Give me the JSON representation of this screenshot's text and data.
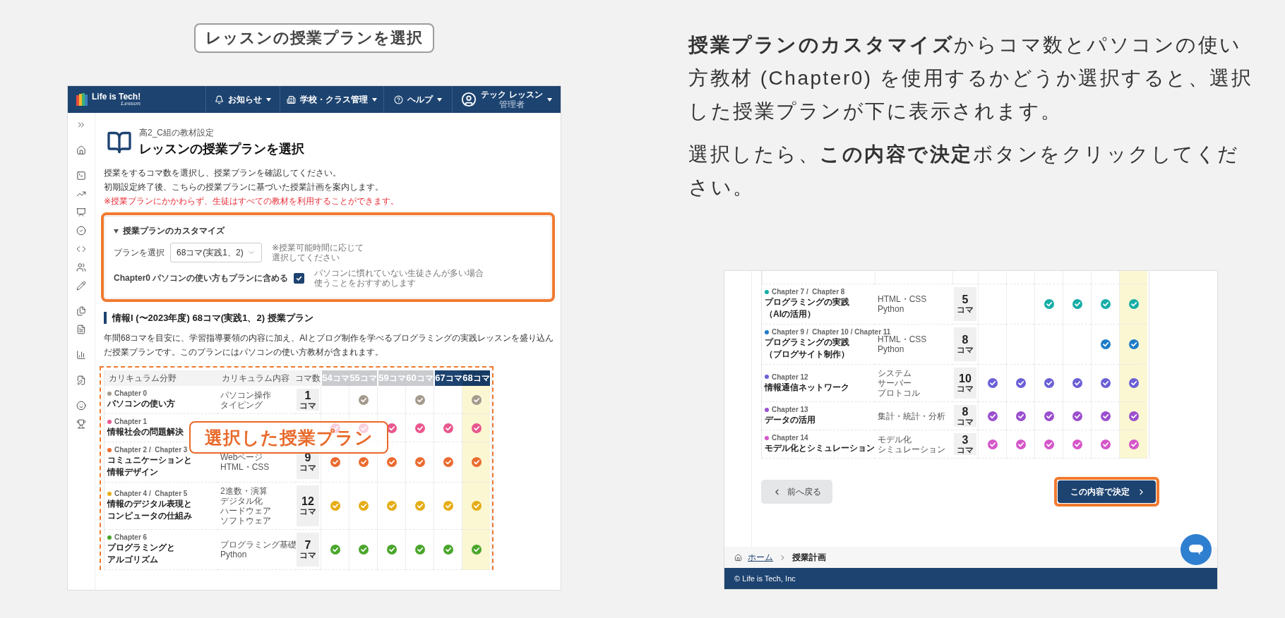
{
  "caption": "レッスンの授業プランを選択",
  "explanation": [
    "**授業プランのカスタマイズ**からコマ数とパソコンの使い方教材 (Chapter0) を使用するかどうか選択すると、選択した授業プランが下に表示されます。",
    "選択したら、**この内容で決定**ボタンをクリックしてください。"
  ],
  "screenshot_top": {
    "header": {
      "logo": "Life is Tech!",
      "logo_sub": "Lesson",
      "nav": [
        {
          "kind": "bell",
          "label": "お知らせ"
        },
        {
          "kind": "building",
          "label": "学校・クラス管理"
        },
        {
          "kind": "help",
          "label": "ヘルプ"
        }
      ],
      "user": {
        "name": "テック レッスン",
        "role": "管理者"
      }
    },
    "subtitle": "高2_C組の教材設定",
    "title": "レッスンの授業プランを選択",
    "intro": [
      "授業をするコマ数を選択し、授業プランを確認してください。",
      "初期設定終了後、こちらの授業プランに基づいた授業計画を案内します。"
    ],
    "notice": "※授業プランにかかわらず、生徒はすべての教材を利用することができます。",
    "customize": {
      "heading": "授業プランのカスタマイズ",
      "expanded": true,
      "plan_label": "プランを選択",
      "plan_value": "68コマ(実践1、2)",
      "plan_hint": [
        "※授業可能時間に応じて",
        "選択してください"
      ],
      "chapter0_label": "Chapter0 パソコンの使い方もプランに含める",
      "chapter0_checked": true,
      "chapter0_hint": [
        "パソコンに慣れていない生徒さんが多い場合",
        "使うことをおすすめします"
      ]
    },
    "plan_heading": "情報I (〜2023年度) 68コマ(実践1、2) 授業プラン",
    "plan_description": "年間68コマを目安に、学習指導要領の内容に加え、AIとブログ制作を学べるプログラミングの実践レッスンを盛り込んだ授業プランです。このプランにはパソコンの使い方教材が含まれます。",
    "table": {
      "columns": [
        "カリキュラム分野",
        "カリキュラム内容",
        "コマ数"
      ],
      "plan_groups": [
        {
          "selected": false,
          "plans": [
            {
              "number": "54",
              "unit": "コマ",
              "selected": false
            },
            {
              "number": "55",
              "unit": "コマ",
              "selected": false
            }
          ]
        },
        {
          "selected": false,
          "plans": [
            {
              "number": "59",
              "unit": "コマ",
              "selected": false
            },
            {
              "number": "60",
              "unit": "コマ",
              "selected": false
            }
          ]
        },
        {
          "selected": true,
          "plans": [
            {
              "number": "67",
              "unit": "コマ",
              "selected": false
            },
            {
              "number": "68",
              "unit": "コマ",
              "selected": true
            }
          ]
        }
      ],
      "rows": [
        {
          "chapter": "Chapter 0",
          "color": "#a39a8c",
          "name": [
            "パソコンの使い方"
          ],
          "content": [
            "パソコン操作",
            "タイピング"
          ],
          "count": "1",
          "unit": "コマ",
          "checks": [
            false,
            true,
            false,
            true,
            false,
            true
          ]
        },
        {
          "chapter": "Chapter 1",
          "color": "#e9578e",
          "name": [
            "情報社会の問題解決"
          ],
          "checks": [
            true,
            true,
            true,
            true,
            true,
            true
          ]
        },
        {
          "chapter": "Chapter 2 /  Chapter 3",
          "color": "#ea6b2f",
          "name": [
            "コミュニケーションと",
            "情報デザイン"
          ],
          "content": [
            "Webページ",
            "HTML・CSS"
          ],
          "count": "9",
          "unit": "コマ",
          "checks": [
            true,
            true,
            true,
            true,
            true,
            true
          ]
        },
        {
          "chapter": "Chapter 4 /  Chapter 5",
          "color": "#e5ad17",
          "name": [
            "情報のデジタル表現と",
            "コンピュータの仕組み"
          ],
          "content": [
            "2進数・演算",
            "デジタル化",
            "ハードウェア",
            "ソフトウェア"
          ],
          "count": "12",
          "unit": "コマ",
          "checks": [
            true,
            true,
            true,
            true,
            true,
            true
          ]
        },
        {
          "chapter": "Chapter 6",
          "color": "#4aa62b",
          "name": [
            "プログラミングと",
            "アルゴリズム"
          ],
          "content": [
            "プログラミング基礎",
            "Python"
          ],
          "count": "7",
          "unit": "コマ",
          "checks": [
            true,
            true,
            true,
            true,
            true,
            true
          ]
        }
      ]
    },
    "overlay_label": "選択した授業プラン"
  },
  "screenshot_bottom": {
    "table": {
      "plan_columns": [
        {
          "selected": false
        },
        {
          "selected": false
        },
        {
          "selected": false
        },
        {
          "selected": false
        },
        {
          "selected": false
        },
        {
          "selected": true
        }
      ],
      "rows": [
        {
          "chapter": "Chapter 7 /  Chapter 8",
          "color": "#17ada7",
          "name": [
            "プログラミングの実践",
            "（AIの活用）"
          ],
          "content": [
            "HTML・CSS",
            "Python"
          ],
          "count": "5",
          "unit": "コマ",
          "checks": [
            false,
            false,
            true,
            true,
            true,
            true
          ]
        },
        {
          "chapter": "Chapter 9 /  Chapter 10 / Chapter 11",
          "color": "#1e7cc8",
          "name": [
            "プログラミングの実践",
            "（ブログサイト制作）"
          ],
          "content": [
            "HTML・CSS",
            "Python"
          ],
          "count": "8",
          "unit": "コマ",
          "checks": [
            false,
            false,
            false,
            false,
            true,
            true
          ]
        },
        {
          "chapter": "Chapter 12",
          "color": "#6b5fd6",
          "name": [
            "情報通信ネットワーク"
          ],
          "content": [
            "システム",
            "サーバー",
            "プロトコル"
          ],
          "count": "10",
          "unit": "コマ",
          "checks": [
            true,
            true,
            true,
            true,
            true,
            true
          ]
        },
        {
          "chapter": "Chapter 13",
          "color": "#9b4fcf",
          "name": [
            "データの活用"
          ],
          "content": [
            "集計・統計・分析"
          ],
          "count": "8",
          "unit": "コマ",
          "checks": [
            true,
            true,
            true,
            true,
            true,
            true
          ]
        },
        {
          "chapter": "Chapter 14",
          "color": "#d557c9",
          "name": [
            "モデル化とシミュレーション"
          ],
          "content": [
            "モデル化",
            "シミュレーション"
          ],
          "count": "3",
          "unit": "コマ",
          "checks": [
            true,
            true,
            true,
            true,
            true,
            true
          ]
        }
      ]
    },
    "back_button": "前へ戻る",
    "confirm_button": "この内容で決定",
    "breadcrumb": [
      "ホーム",
      "授業計画"
    ],
    "footer": "© Life is Tech, Inc"
  }
}
